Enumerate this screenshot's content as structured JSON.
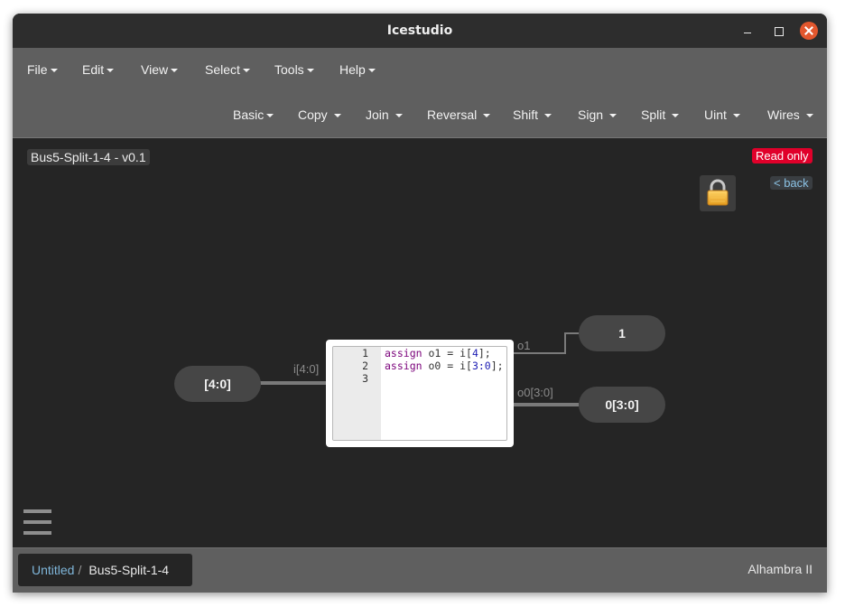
{
  "window": {
    "title": "Icestudio"
  },
  "menubar": {
    "top": [
      {
        "label": "File"
      },
      {
        "label": "Edit"
      },
      {
        "label": "View"
      },
      {
        "label": "Select"
      },
      {
        "label": "Tools"
      },
      {
        "label": "Help"
      }
    ],
    "collections": [
      {
        "label": "Basic"
      },
      {
        "label": "Copy"
      },
      {
        "label": "Join"
      },
      {
        "label": "Reversal"
      },
      {
        "label": "Shift"
      },
      {
        "label": "Sign"
      },
      {
        "label": "Split"
      },
      {
        "label": "Uint"
      },
      {
        "label": "Wires"
      }
    ]
  },
  "canvas": {
    "project_title": "Bus5-Split-1-4 - v0.1",
    "read_only": "Read only",
    "back": "< back",
    "lock_icon": "lock-icon",
    "input_port": {
      "label": "[4:0]",
      "wire_label": "i[4:0]"
    },
    "output_ports": [
      {
        "label": "1",
        "wire_label": "o1"
      },
      {
        "label": "0[3:0]",
        "wire_label": "o0[3:0]"
      }
    ],
    "code_block": {
      "line_numbers": [
        "1",
        "2",
        "3"
      ],
      "lines": [
        [
          {
            "t": "assign",
            "c": "kw"
          },
          {
            "t": " o1 = i[",
            "c": ""
          },
          {
            "t": "4",
            "c": "num"
          },
          {
            "t": "];",
            "c": ""
          }
        ],
        [
          {
            "t": "assign",
            "c": "kw"
          },
          {
            "t": " o0 = i[",
            "c": ""
          },
          {
            "t": "3:0",
            "c": "num"
          },
          {
            "t": "];",
            "c": ""
          }
        ],
        []
      ]
    }
  },
  "footer": {
    "breadcrumb_root": "Untitled",
    "breadcrumb_separator": "/",
    "breadcrumb_current": "Bus5-Split-1-4",
    "board": "Alhambra II"
  },
  "colors": {
    "canvas_bg": "#252525",
    "toolbar_bg": "#5f5f5f",
    "read_only_badge": "#e0002a",
    "wire": "#7a7a7a",
    "port_bg": "#464646",
    "link": "#7fb6da"
  }
}
